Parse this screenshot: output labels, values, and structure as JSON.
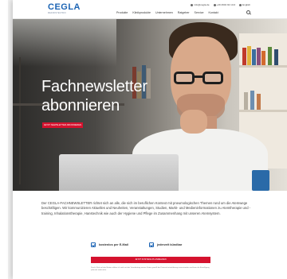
{
  "header": {
    "logo": {
      "main": "CEGLA",
      "sub": "MEDIZINTECHNIK"
    },
    "utility": [
      {
        "icon": "email-icon",
        "label": "info@cegla.de"
      },
      {
        "icon": "phone-icon",
        "label": "+49 2602 92 13-0"
      },
      {
        "icon": "language-icon",
        "label": "English"
      }
    ],
    "nav": [
      "Produkte",
      "Klinikprodukte",
      "Unternehmen",
      "Ratgeber",
      "Service",
      "Kontakt"
    ]
  },
  "hero": {
    "title_line1": "Fachnewsletter",
    "title_line2": "abonnieren",
    "button_label": "JETZT NEWSLETTER ABONNIEREN"
  },
  "intro": {
    "text": "Der CEGLA-FACHNEWSLETTER richtet sich an alle, die sich im beruflichen Kontext mit pneumologischen Themen rund um die Atemwege beschäftigen. Wir kommunizieren Aktuelles und Neuheiten, Veranstaltungen, Studien, Markt- und Medieninformationen zu Atemtherapie und -training, Inhalationstherapie, Hanstechnik wie auch der Hygiene und Pflege im Zusammenhang mit unseren Atemsystem."
  },
  "features": [
    {
      "label": "kostenlos per E-Mail"
    },
    {
      "label": "jederzeit kündbar"
    }
  ],
  "cta": {
    "label": "JETZT KOSTENLOS ANMELDEN"
  },
  "smallprint": "Durch Klick auf den Button erkläre ich mich mit der Verarbeitung meiner Daten gemäß der Datenschutzerklärung einverstanden und kann die Einwilligung jederzeit widerrufen.",
  "colors": {
    "brand_blue": "#1c64b4",
    "accent_red": "#d5122e"
  }
}
